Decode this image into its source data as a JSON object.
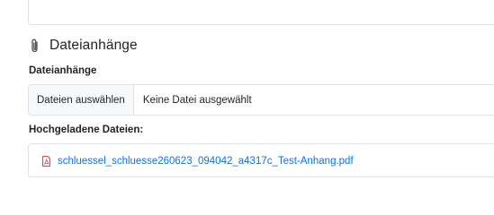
{
  "attachments": {
    "section_title": "Dateianhänge",
    "section_icon": "paperclip-icon",
    "field_label": "Dateianhänge",
    "file_input": {
      "button_label": "Dateien auswählen",
      "status_text": "Keine Datei ausgewählt"
    },
    "uploaded": {
      "label": "Hochgeladene Dateien:",
      "files": [
        {
          "name": "schluessel_schluesse260623_094042_a4317c_Test-Anhang.pdf",
          "icon": "pdf-file-icon"
        }
      ]
    }
  },
  "colors": {
    "link": "#0d6efd",
    "pdf_icon": "#dc3545",
    "border": "#dee2e6",
    "button_bg": "#f8f9fa"
  }
}
